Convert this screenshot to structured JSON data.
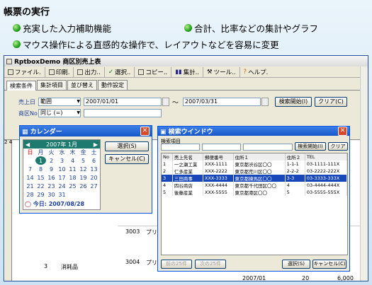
{
  "slide": {
    "title": "帳票の実行",
    "bullets": [
      "充実した入力補助機能",
      "合計、比率などの集計やグラフ",
      "マウス操作による直感的な操作で、レイアウトなどを容易に変更"
    ]
  },
  "app": {
    "title": "RptboxDemo 商区別売上表",
    "toolbar": [
      "ファイル.",
      "印刷.",
      "出力..",
      "選択..",
      "コピー..",
      "集計..",
      "ツール..",
      "ヘルプ."
    ],
    "tabs": [
      "検索条件",
      "集計項目",
      "並び替え",
      "動作設定"
    ],
    "filters": {
      "date_label": "売上日",
      "date_mode": "範囲",
      "date_from": "2007/01/01",
      "date_to": "2007/03/31",
      "code_label": "商区No",
      "code_mode": "同じ (=)"
    },
    "buttons": {
      "search": "検索開始(I)",
      "clear": "クリア(C)"
    },
    "bg_rows": [
      {
        "c1": "3003",
        "c2": "プリ"
      },
      {
        "c0": "3",
        "c0b": "消耗品",
        "c1": "3004",
        "c2": "プリ"
      }
    ],
    "bottom": {
      "date": "2007/01",
      "qty": "20",
      "amount": "6,000"
    }
  },
  "calendar": {
    "title": "カレンダー",
    "month": "2007年 1月",
    "select": "選択(S)",
    "cancel": "キャンセル(C)",
    "days": [
      "日",
      "月",
      "火",
      "水",
      "木",
      "金",
      "土"
    ],
    "weeks": [
      [
        "",
        "1",
        "2",
        "3",
        "4",
        "5",
        "6"
      ],
      [
        "7",
        "8",
        "9",
        "10",
        "11",
        "12",
        "13"
      ],
      [
        "14",
        "15",
        "16",
        "17",
        "18",
        "19",
        "20"
      ],
      [
        "21",
        "22",
        "23",
        "24",
        "25",
        "26",
        "27"
      ],
      [
        "28",
        "29",
        "30",
        "31",
        "",
        "",
        ""
      ]
    ],
    "today": "今日: 2007/08/28"
  },
  "search": {
    "title": "検索ウインドウ",
    "label": "検索項目",
    "start": "検索開始(I)",
    "clear": "クリア",
    "headers": [
      "No",
      "売上先名",
      "郵便番号",
      "住所１",
      "住所２",
      "TEL"
    ],
    "rows": [
      [
        "1",
        "一之瀬工業",
        "XXX-1111",
        "東京都渋谷区〇〇",
        "1-1-1",
        "03-1111-111X"
      ],
      [
        "2",
        "仁多産業",
        "XXX-2222",
        "東京都荒川区〇〇",
        "2-2-2",
        "03-2222-222X"
      ],
      [
        "3",
        "三田商事",
        "XXX-3333",
        "東京都練馬区〇〇",
        "3-3",
        "03-3333-333X"
      ],
      [
        "4",
        "四谷商店",
        "XXX-4444",
        "東京都千代田区〇〇",
        "4",
        "03-4444-444X"
      ],
      [
        "5",
        "後藤産業",
        "XXX-5555",
        "東京都港区〇〇",
        "5",
        "03-5555-555X"
      ]
    ],
    "prev": "前の25件",
    "next": "次の25件",
    "select": "選択(S)",
    "cancel": "キャンセル(C)"
  }
}
